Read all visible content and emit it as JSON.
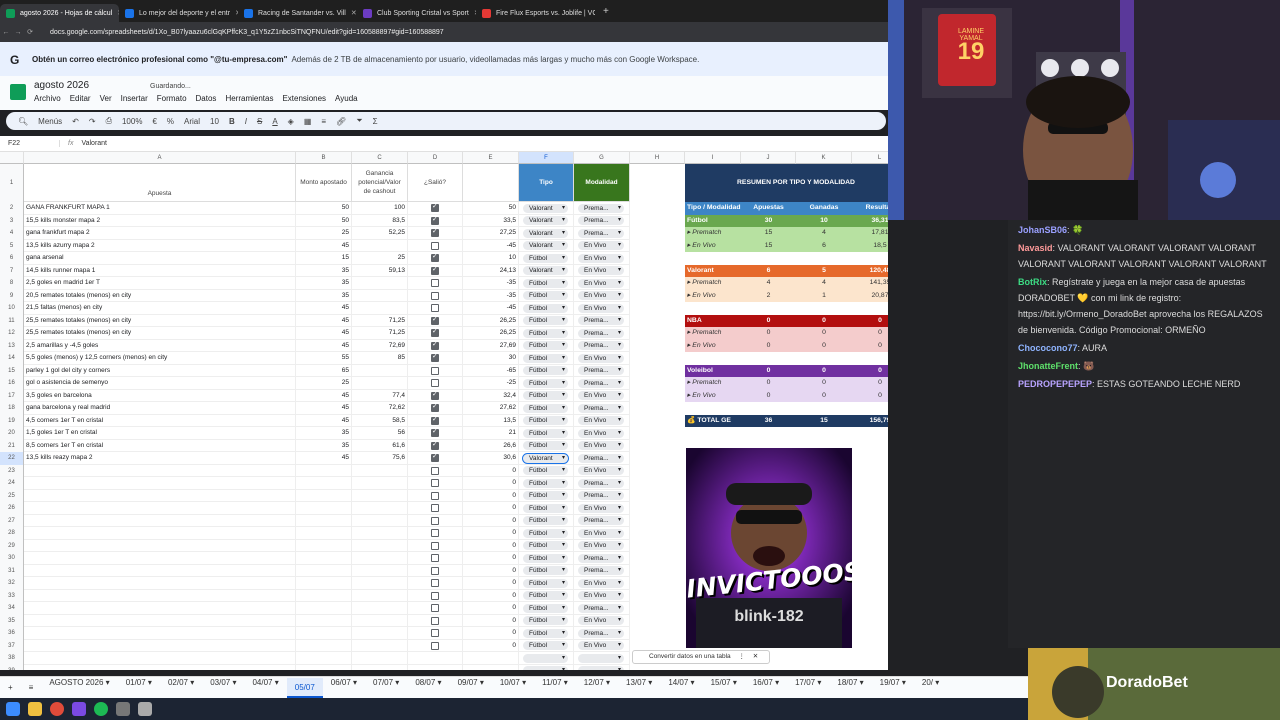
{
  "browser": {
    "tabs": [
      {
        "title": "agosto 2026 - Hojas de cálcul",
        "active": true,
        "color": "#0f9d58"
      },
      {
        "title": "Lo mejor del deporte y el entr",
        "active": false,
        "color": "#1a73e8"
      },
      {
        "title": "Racing de Santander vs. Vill",
        "active": false,
        "color": "#1a73e8"
      },
      {
        "title": "Club Sporting Cristal vs Sport",
        "active": false,
        "color": "#6c3cc2"
      },
      {
        "title": "Fire Flux Esports vs. Joblife | VC",
        "active": false,
        "color": "#e53935"
      }
    ],
    "url": "docs.google.com/spreadsheets/d/1Xo_B07lyaazu6clGqKPffcK3_q1Y5zZ1nbcSiTNQFNU/edit?gid=160588897#gid=160588897"
  },
  "banner": {
    "bold": "Obtén un correo electrónico profesional como \"@tu-empresa.com\"",
    "text": "Además de 2 TB de almacenamiento por usuario, videollamadas más largas y mucho más con Google Workspace."
  },
  "doc": {
    "title": "agosto 2026",
    "status": "Guardando...",
    "menu": [
      "Archivo",
      "Editar",
      "Ver",
      "Insertar",
      "Formato",
      "Datos",
      "Herramientas",
      "Extensiones",
      "Ayuda"
    ]
  },
  "toolbar": {
    "menus": "Menús",
    "zoom": "100%",
    "font": "Arial",
    "size": "10",
    "currency": "€",
    "percent": "%"
  },
  "formula": {
    "ref": "F22",
    "fx": "fx",
    "value": "Valorant"
  },
  "columns": [
    "A",
    "B",
    "C",
    "D",
    "E",
    "F",
    "G",
    "H",
    "I",
    "J",
    "K",
    "L"
  ],
  "headers": {
    "apuesta": "Apuesta",
    "monto": "Monto apostado",
    "ganancia": "Ganancia potencial/Valor de cashout",
    "salio": "¿Salió?",
    "tipo": "Tipo",
    "modalidad": "Modalidad"
  },
  "rows": [
    {
      "n": "2",
      "a": "GANA FRANKFURT MAPA 1",
      "b": "50",
      "c": "100",
      "d": true,
      "e": "50",
      "f": "Valorant",
      "g": "Prema..."
    },
    {
      "n": "3",
      "a": "15,5 kills monster mapa 2",
      "b": "50",
      "c": "83,5",
      "d": true,
      "e": "33,5",
      "f": "Valorant",
      "g": "Prema..."
    },
    {
      "n": "4",
      "a": "gana frankfurt mapa 2",
      "b": "25",
      "c": "52,25",
      "d": true,
      "e": "27,25",
      "f": "Valorant",
      "g": "Prema..."
    },
    {
      "n": "5",
      "a": "13,5 kills azurry mapa 2",
      "b": "45",
      "c": "",
      "d": false,
      "e": "-45",
      "f": "Valorant",
      "g": "En Vivo"
    },
    {
      "n": "6",
      "a": "gana arsenal",
      "b": "15",
      "c": "25",
      "d": true,
      "e": "10",
      "f": "Fútbol",
      "g": "En Vivo"
    },
    {
      "n": "7",
      "a": "14,5 kills runner mapa 1",
      "b": "35",
      "c": "59,13",
      "d": true,
      "e": "24,13",
      "f": "Valorant",
      "g": "En Vivo"
    },
    {
      "n": "8",
      "a": "2,5 goles en madrid 1er T",
      "b": "35",
      "c": "",
      "d": false,
      "e": "-35",
      "f": "Fútbol",
      "g": "En Vivo"
    },
    {
      "n": "9",
      "a": "20,5 remates totales (menos) en city",
      "b": "35",
      "c": "",
      "d": false,
      "e": "-35",
      "f": "Fútbol",
      "g": "En Vivo"
    },
    {
      "n": "10",
      "a": "21,5 faltas (menos) en city",
      "b": "45",
      "c": "",
      "d": false,
      "e": "-45",
      "f": "Fútbol",
      "g": "En Vivo"
    },
    {
      "n": "11",
      "a": "25,5 remates totales (menos) en city",
      "b": "45",
      "c": "71,25",
      "d": true,
      "e": "26,25",
      "f": "Fútbol",
      "g": "Prema..."
    },
    {
      "n": "12",
      "a": "25,5 remates totales (menos) en city",
      "b": "45",
      "c": "71,25",
      "d": true,
      "e": "26,25",
      "f": "Fútbol",
      "g": "Prema..."
    },
    {
      "n": "13",
      "a": "2,5 amarillas y -4,5 goles",
      "b": "45",
      "c": "72,69",
      "d": true,
      "e": "27,69",
      "f": "Fútbol",
      "g": "Prema..."
    },
    {
      "n": "14",
      "a": "5,5 goles (menos) y 12,5 corners (menos) en city",
      "b": "55",
      "c": "85",
      "d": true,
      "e": "30",
      "f": "Fútbol",
      "g": "En Vivo"
    },
    {
      "n": "15",
      "a": "parley 1 gol del city y corners",
      "b": "65",
      "c": "",
      "d": false,
      "e": "-65",
      "f": "Fútbol",
      "g": "Prema..."
    },
    {
      "n": "16",
      "a": "gol o asistencia de semenyo",
      "b": "25",
      "c": "",
      "d": false,
      "e": "-25",
      "f": "Fútbol",
      "g": "Prema..."
    },
    {
      "n": "17",
      "a": "3,5 goles en barcelona",
      "b": "45",
      "c": "77,4",
      "d": true,
      "e": "32,4",
      "f": "Fútbol",
      "g": "En Vivo"
    },
    {
      "n": "18",
      "a": "gana barcelona y real madrid",
      "b": "45",
      "c": "72,62",
      "d": true,
      "e": "27,62",
      "f": "Fútbol",
      "g": "Prema..."
    },
    {
      "n": "19",
      "a": "4,5 corners 1er T en cristal",
      "b": "45",
      "c": "58,5",
      "d": true,
      "e": "13,5",
      "f": "Fútbol",
      "g": "En Vivo"
    },
    {
      "n": "20",
      "a": "1,5 goles 1er T en cristal",
      "b": "35",
      "c": "56",
      "d": true,
      "e": "21",
      "f": "Fútbol",
      "g": "En Vivo"
    },
    {
      "n": "21",
      "a": "8,5 corners 1er T en cristal",
      "b": "35",
      "c": "61,6",
      "d": true,
      "e": "26,6",
      "f": "Fútbol",
      "g": "En Vivo"
    },
    {
      "n": "22",
      "a": "13,5 kills reazy mapa 2",
      "b": "45",
      "c": "75,6",
      "d": true,
      "e": "30,6",
      "f": "Valorant",
      "g": "Prema..."
    },
    {
      "n": "23",
      "a": "",
      "b": "",
      "c": "",
      "d": false,
      "e": "0",
      "f": "Fútbol",
      "g": "En Vivo"
    },
    {
      "n": "24",
      "a": "",
      "b": "",
      "c": "",
      "d": false,
      "e": "0",
      "f": "Fútbol",
      "g": "Prema..."
    },
    {
      "n": "25",
      "a": "",
      "b": "",
      "c": "",
      "d": false,
      "e": "0",
      "f": "Fútbol",
      "g": "Prema..."
    },
    {
      "n": "26",
      "a": "",
      "b": "",
      "c": "",
      "d": false,
      "e": "0",
      "f": "Fútbol",
      "g": "En Vivo"
    },
    {
      "n": "27",
      "a": "",
      "b": "",
      "c": "",
      "d": false,
      "e": "0",
      "f": "Fútbol",
      "g": "Prema..."
    },
    {
      "n": "28",
      "a": "",
      "b": "",
      "c": "",
      "d": false,
      "e": "0",
      "f": "Fútbol",
      "g": "En Vivo"
    },
    {
      "n": "29",
      "a": "",
      "b": "",
      "c": "",
      "d": false,
      "e": "0",
      "f": "Fútbol",
      "g": "En Vivo"
    },
    {
      "n": "30",
      "a": "",
      "b": "",
      "c": "",
      "d": false,
      "e": "0",
      "f": "Fútbol",
      "g": "Prema..."
    },
    {
      "n": "31",
      "a": "",
      "b": "",
      "c": "",
      "d": false,
      "e": "0",
      "f": "Fútbol",
      "g": "Prema..."
    },
    {
      "n": "32",
      "a": "",
      "b": "",
      "c": "",
      "d": false,
      "e": "0",
      "f": "Fútbol",
      "g": "En Vivo"
    },
    {
      "n": "33",
      "a": "",
      "b": "",
      "c": "",
      "d": false,
      "e": "0",
      "f": "Fútbol",
      "g": "En Vivo"
    },
    {
      "n": "34",
      "a": "",
      "b": "",
      "c": "",
      "d": false,
      "e": "0",
      "f": "Fútbol",
      "g": "Prema..."
    },
    {
      "n": "35",
      "a": "",
      "b": "",
      "c": "",
      "d": false,
      "e": "0",
      "f": "Fútbol",
      "g": "En Vivo"
    },
    {
      "n": "36",
      "a": "",
      "b": "",
      "c": "",
      "d": false,
      "e": "0",
      "f": "Fútbol",
      "g": "Prema..."
    },
    {
      "n": "37",
      "a": "",
      "b": "",
      "c": "",
      "d": false,
      "e": "0",
      "f": "Fútbol",
      "g": "En Vivo"
    },
    {
      "n": "38",
      "a": "",
      "b": "",
      "c": "",
      "d": false,
      "e": "",
      "f": "",
      "g": ""
    },
    {
      "n": "39",
      "a": "",
      "b": "",
      "c": "",
      "d": false,
      "e": "",
      "f": "",
      "g": ""
    }
  ],
  "summary": {
    "title": "RESUMEN POR TIPO Y MODALIDAD",
    "cols": [
      "Tipo / Modalidad",
      "Apuestas",
      "Ganadas",
      "Resultad"
    ],
    "blocks": [
      {
        "name": "Fútbol",
        "apuestas": "30",
        "ganadas": "10",
        "resultado": "36,31",
        "color": "#b7e1a1",
        "head": "#6aa84f",
        "rows": [
          {
            "name": "▸ Prematch",
            "a": "15",
            "g": "4",
            "r": "17,81"
          },
          {
            "name": "▸ En Vivo",
            "a": "15",
            "g": "6",
            "r": "18,5"
          }
        ]
      },
      {
        "name": "Valorant",
        "apuestas": "6",
        "ganadas": "5",
        "resultado": "120,48",
        "color": "#fce5cd",
        "head": "#e6692b",
        "rows": [
          {
            "name": "▸ Prematch",
            "a": "4",
            "g": "4",
            "r": "141,35"
          },
          {
            "name": "▸ En Vivo",
            "a": "2",
            "g": "1",
            "r": "20,87"
          }
        ]
      },
      {
        "name": "NBA",
        "apuestas": "0",
        "ganadas": "0",
        "resultado": "0",
        "color": "#f4cccc",
        "head": "#b30f0f",
        "rows": [
          {
            "name": "▸ Prematch",
            "a": "0",
            "g": "0",
            "r": "0"
          },
          {
            "name": "▸ En Vivo",
            "a": "0",
            "g": "0",
            "r": "0"
          }
        ]
      },
      {
        "name": "Voleibol",
        "apuestas": "0",
        "ganadas": "0",
        "resultado": "0",
        "color": "#e6d7f2",
        "head": "#7030a0",
        "rows": [
          {
            "name": "▸ Prematch",
            "a": "0",
            "g": "0",
            "r": "0"
          },
          {
            "name": "▸ En Vivo",
            "a": "0",
            "g": "0",
            "r": "0"
          }
        ]
      }
    ],
    "total": {
      "name": "💰 TOTAL GE",
      "apuestas": "36",
      "ganadas": "15",
      "resultado": "156,79"
    }
  },
  "thumbnail": {
    "text": "INVICTOOOS",
    "sub": "blink-182"
  },
  "toast": {
    "text": "Convertir datos en una tabla"
  },
  "sheet_tabs": [
    "AGOSTO 2026",
    "01/07",
    "02/07",
    "03/07",
    "04/07",
    "05/07",
    "06/07",
    "07/07",
    "08/07",
    "09/07",
    "10/07",
    "11/07",
    "12/07",
    "13/07",
    "14/07",
    "15/07",
    "16/07",
    "17/07",
    "18/07",
    "19/07",
    "20/"
  ],
  "active_sheet": "05/07",
  "chat": [
    {
      "user": "JohanSB06",
      "color": "#9aa0ff",
      "msg": ": 🍀"
    },
    {
      "user": "Navasid",
      "color": "#ff9a9a",
      "msg": ": VALORANT VALORANT VALORANT VALORANT VALORANT VALORANT VALORANT VALORANT VALORANT"
    },
    {
      "user": "BotRix",
      "color": "#3ddc84",
      "msg": ": Regístrate y juega en la mejor casa de apuestas DORADOBET 💛 con mi link de registro: https://bit.ly/Ormeno_DoradoBet aprovecha los REGALAZOS de bienvenida. Código Promocional: ORMEÑO"
    },
    {
      "user": "Chococono77",
      "color": "#8fb4ff",
      "msg": ": AURA"
    },
    {
      "user": "JhonatteFrent",
      "color": "#5ee06b",
      "msg": ": 🐻"
    },
    {
      "user": "PEDROPEPEPEP",
      "color": "#b9a4ff",
      "msg": ": ESTAS GOTEANDO LECHE NERD"
    }
  ],
  "cam": {
    "jersey": "19",
    "jersey_name": "LAMINE YAMAL"
  },
  "brand": {
    "name": "DoradoBet"
  }
}
